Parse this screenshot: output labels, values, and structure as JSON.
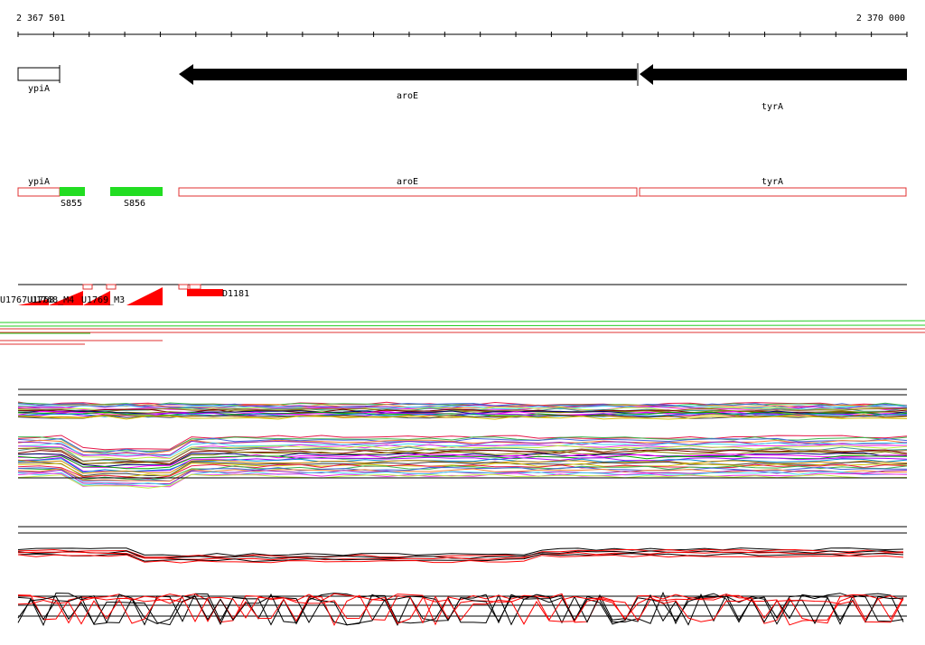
{
  "ruler": {
    "start_label": "2 367 501",
    "end_label": "2 370 000"
  },
  "genes": [
    {
      "name": "ypiA"
    },
    {
      "name": "aroE"
    },
    {
      "name": "tyrA"
    }
  ],
  "segments": [
    {
      "name": "S855"
    },
    {
      "name": "S856"
    }
  ],
  "probe_labels": [
    {
      "name": "U1767"
    },
    {
      "name": "U1768"
    },
    {
      "name": "U1768_M4"
    },
    {
      "name": "U1769_M3"
    },
    {
      "name": "D1181"
    }
  ],
  "colors": {
    "gene_arrow": "#000000",
    "annotation_outline": "#e03030",
    "segment": "#22dd22",
    "probe": "#ff0000",
    "baseline": "#000000"
  }
}
